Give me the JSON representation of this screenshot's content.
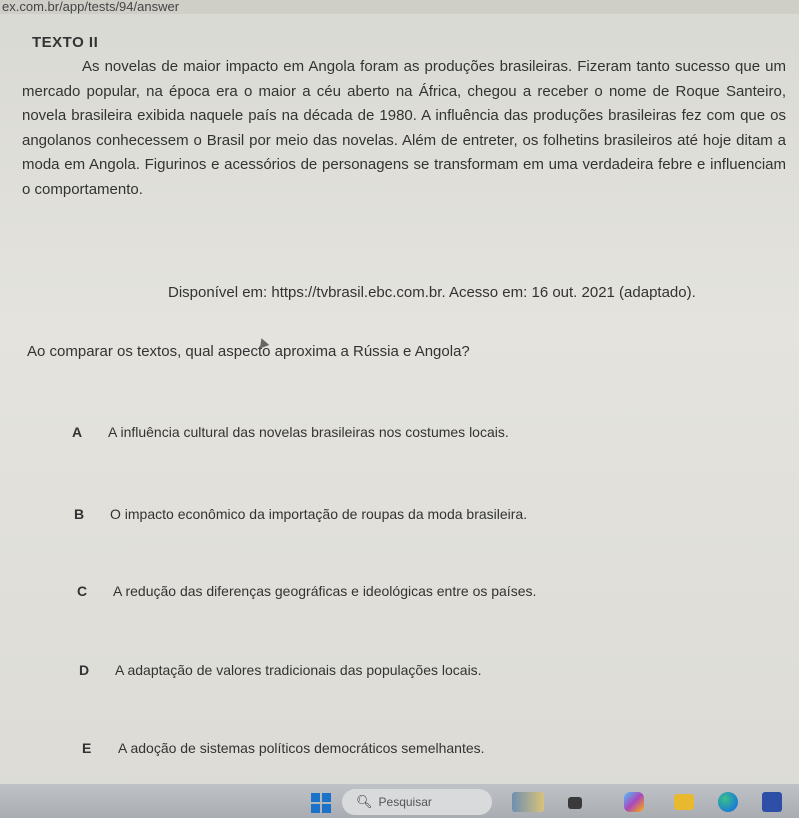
{
  "browser": {
    "url": "ex.com.br/app/tests/94/answer"
  },
  "content": {
    "label": "TEXTO II",
    "passage": "As novelas de maior impacto em Angola foram as produções brasileiras. Fizeram tanto sucesso que um mercado popular, na época era o maior a céu aberto na África, chegou a receber o nome de Roque Santeiro, novela brasileira exibida naquele país na década de 1980. A influência das produções brasileiras fez com que os angolanos conhecessem o Brasil por meio das novelas. Além de entreter, os folhetins brasileiros até hoje ditam a moda em Angola. Figurinos e acessórios de personagens se transformam em uma verdadeira febre e influenciam o comportamento.",
    "source": "Disponível em: https://tvbrasil.ebc.com.br. Acesso em: 16 out. 2021 (adaptado).",
    "question": "Ao comparar os textos, qual aspecto aproxima a Rússia e Angola?",
    "options": [
      {
        "letter": "A",
        "text": "A influência cultural das novelas brasileiras nos costumes locais."
      },
      {
        "letter": "B",
        "text": "O impacto econômico da importação de roupas da moda brasileira."
      },
      {
        "letter": "C",
        "text": "A redução das diferenças geográficas e ideológicas entre os países."
      },
      {
        "letter": "D",
        "text": "A adaptação de valores tradicionais das populações locais."
      },
      {
        "letter": "E",
        "text": "A adoção de sistemas políticos democráticos semelhantes."
      }
    ]
  },
  "taskbar": {
    "search_placeholder": "Pesquisar",
    "icons": [
      "windows-start-icon",
      "search-icon",
      "weather-widget-icon",
      "task-view-icon",
      "copilot-icon",
      "file-explorer-icon",
      "edge-browser-icon",
      "store-icon"
    ],
    "colors": {
      "start": "#1a73c9",
      "edge": "#1b7fd1",
      "explorer": "#e8b92f",
      "store": "#2e4fa8"
    }
  }
}
